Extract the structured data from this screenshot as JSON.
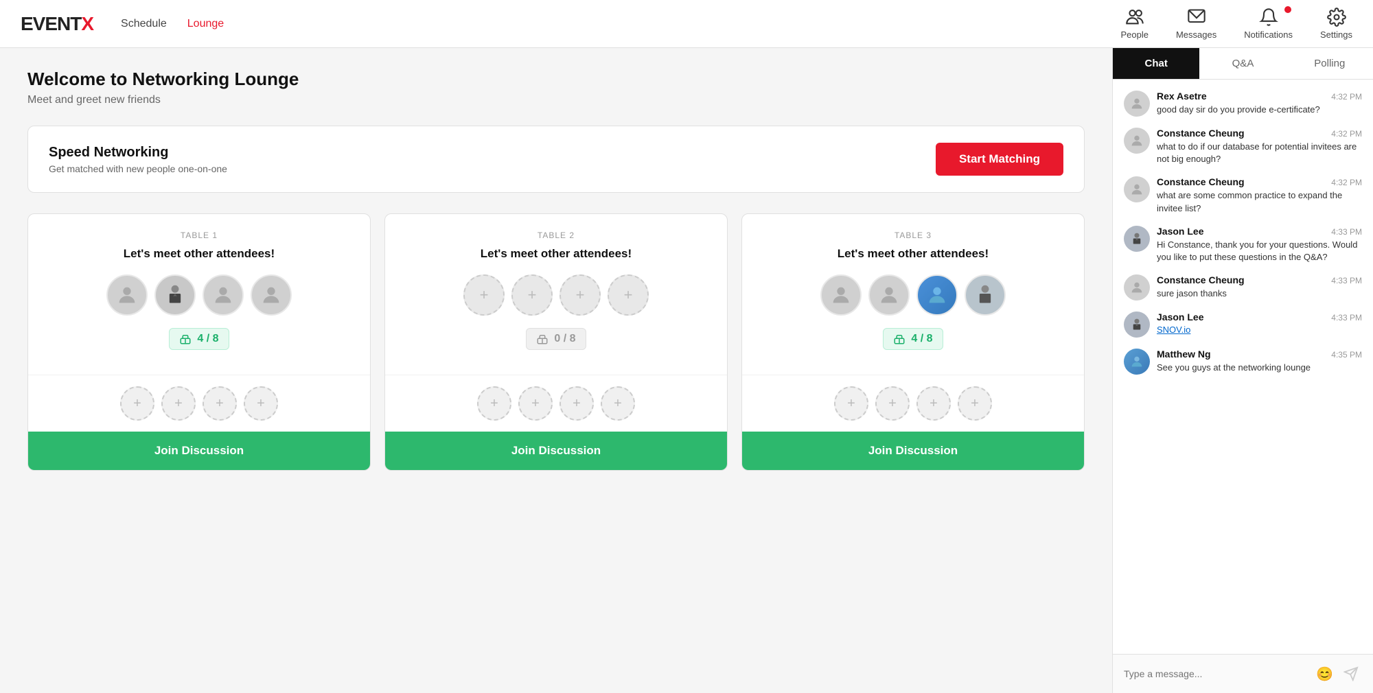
{
  "app": {
    "logo_text": "EVENTX",
    "logo_highlight": "X"
  },
  "nav": {
    "schedule_label": "Schedule",
    "lounge_label": "Lounge",
    "people_label": "People",
    "messages_label": "Messages",
    "notifications_label": "Notifications",
    "settings_label": "Settings"
  },
  "page": {
    "welcome_title": "Welcome to Networking Lounge",
    "welcome_subtitle": "Meet and greet new friends"
  },
  "speed_networking": {
    "title": "Speed Networking",
    "subtitle": "Get matched with new people one-on-one",
    "button_label": "Start Matching"
  },
  "tables": [
    {
      "label": "TABLE 1",
      "title": "Let's meet other attendees!",
      "seat_count": "4 / 8",
      "seat_status": "green",
      "join_label": "Join Discussion",
      "has_people": true
    },
    {
      "label": "TABLE 2",
      "title": "Let's meet other attendees!",
      "seat_count": "0 / 8",
      "seat_status": "gray",
      "join_label": "Join Discussion",
      "has_people": false
    },
    {
      "label": "TABLE 3",
      "title": "Let's meet other attendees!",
      "seat_count": "4 / 8",
      "seat_status": "green",
      "join_label": "Join Discussion",
      "has_people": true
    }
  ],
  "chat": {
    "tabs": [
      "Chat",
      "Q&A",
      "Polling"
    ],
    "active_tab": "Chat",
    "messages": [
      {
        "name": "Rex Asetre",
        "time": "4:32 PM",
        "text": "good day sir do you provide e-certificate?",
        "has_avatar": false
      },
      {
        "name": "Constance Cheung",
        "time": "4:32 PM",
        "text": "what to do if our database for potential invitees are not big enough?",
        "has_avatar": false
      },
      {
        "name": "Constance Cheung",
        "time": "4:32 PM",
        "text": "what are some common practice to expand the invitee list?",
        "has_avatar": false
      },
      {
        "name": "Jason Lee",
        "time": "4:33 PM",
        "text": "Hi Constance, thank you for your questions. Would you like to put these questions in the Q&A?",
        "has_avatar": true,
        "avatar_type": "suit"
      },
      {
        "name": "Constance Cheung",
        "time": "4:33 PM",
        "text": "sure jason thanks",
        "has_avatar": false
      },
      {
        "name": "Jason Lee",
        "time": "4:33 PM",
        "text": "",
        "link": "SNOV.io",
        "has_avatar": true,
        "avatar_type": "suit"
      },
      {
        "name": "Matthew Ng",
        "time": "4:35 PM",
        "text": "See you guys at the networking lounge",
        "has_avatar": true,
        "avatar_type": "photo"
      }
    ],
    "input_placeholder": "Type a message..."
  }
}
